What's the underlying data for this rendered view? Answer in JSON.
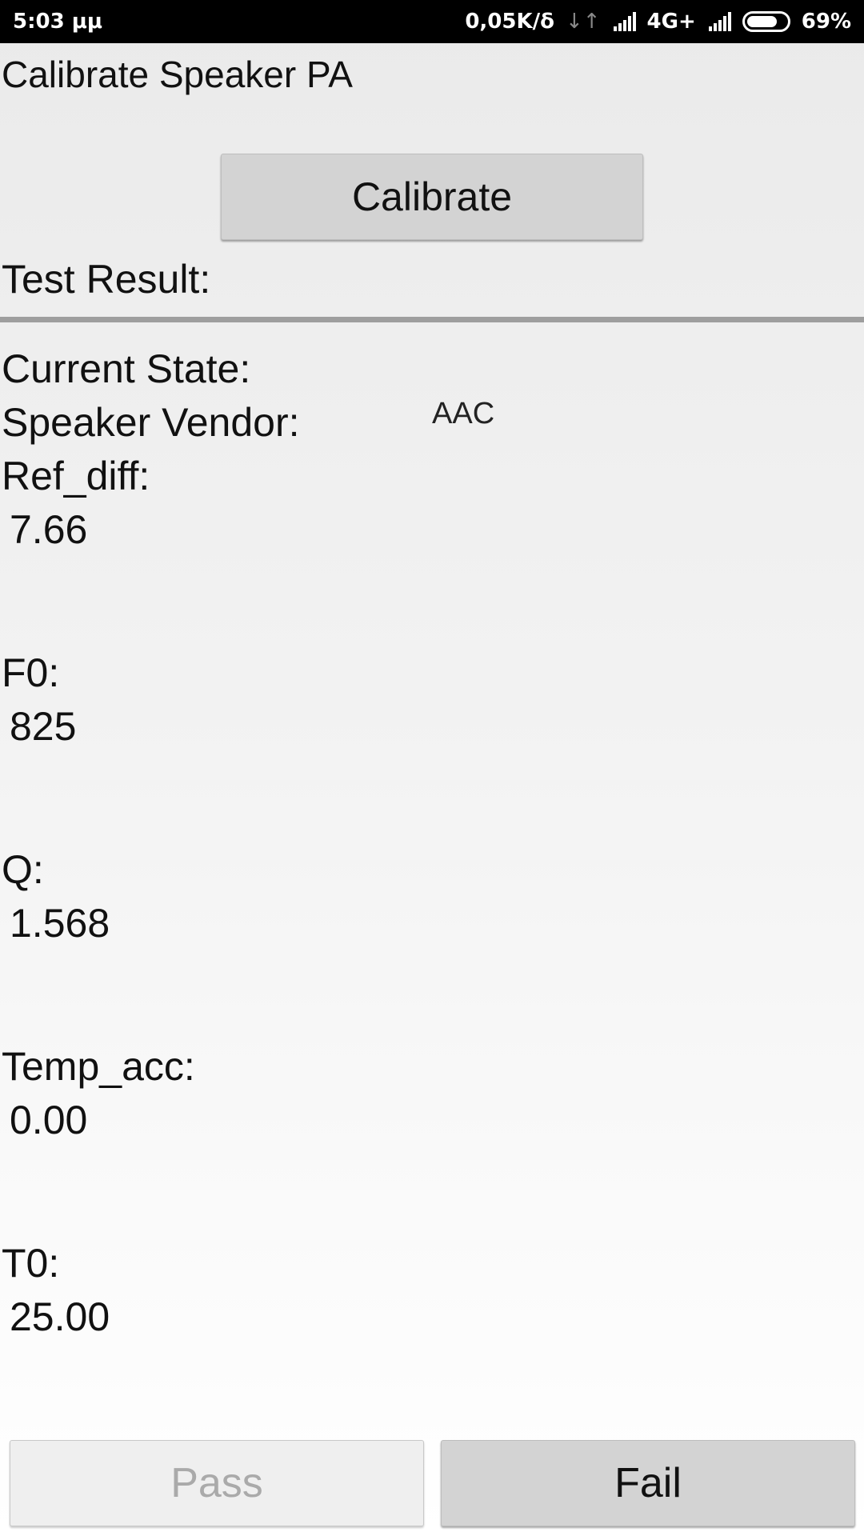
{
  "status_bar": {
    "time": "5:03 μμ",
    "net_speed": "0,05K/δ",
    "updown_glyph": "↓↑",
    "network_type": "4G+",
    "battery_percent": "69%",
    "battery_level": 0.69
  },
  "title": "Calibrate Speaker PA",
  "calibrate_button": "Calibrate",
  "test_result_label": "Test Result:",
  "current_state_label": "Current State:",
  "speaker_vendor_label": "Speaker Vendor:",
  "speaker_vendor_value": "AAC",
  "fields": {
    "ref_diff": {
      "label": "Ref_diff:",
      "value": "7.66"
    },
    "f0": {
      "label": "F0:",
      "value": "825"
    },
    "q": {
      "label": "Q:",
      "value": "1.568"
    },
    "temp_acc": {
      "label": "Temp_acc:",
      "value": "0.00"
    },
    "t0": {
      "label": "T0:",
      "value": "25.00"
    }
  },
  "buttons": {
    "pass": "Pass",
    "fail": "Fail"
  }
}
